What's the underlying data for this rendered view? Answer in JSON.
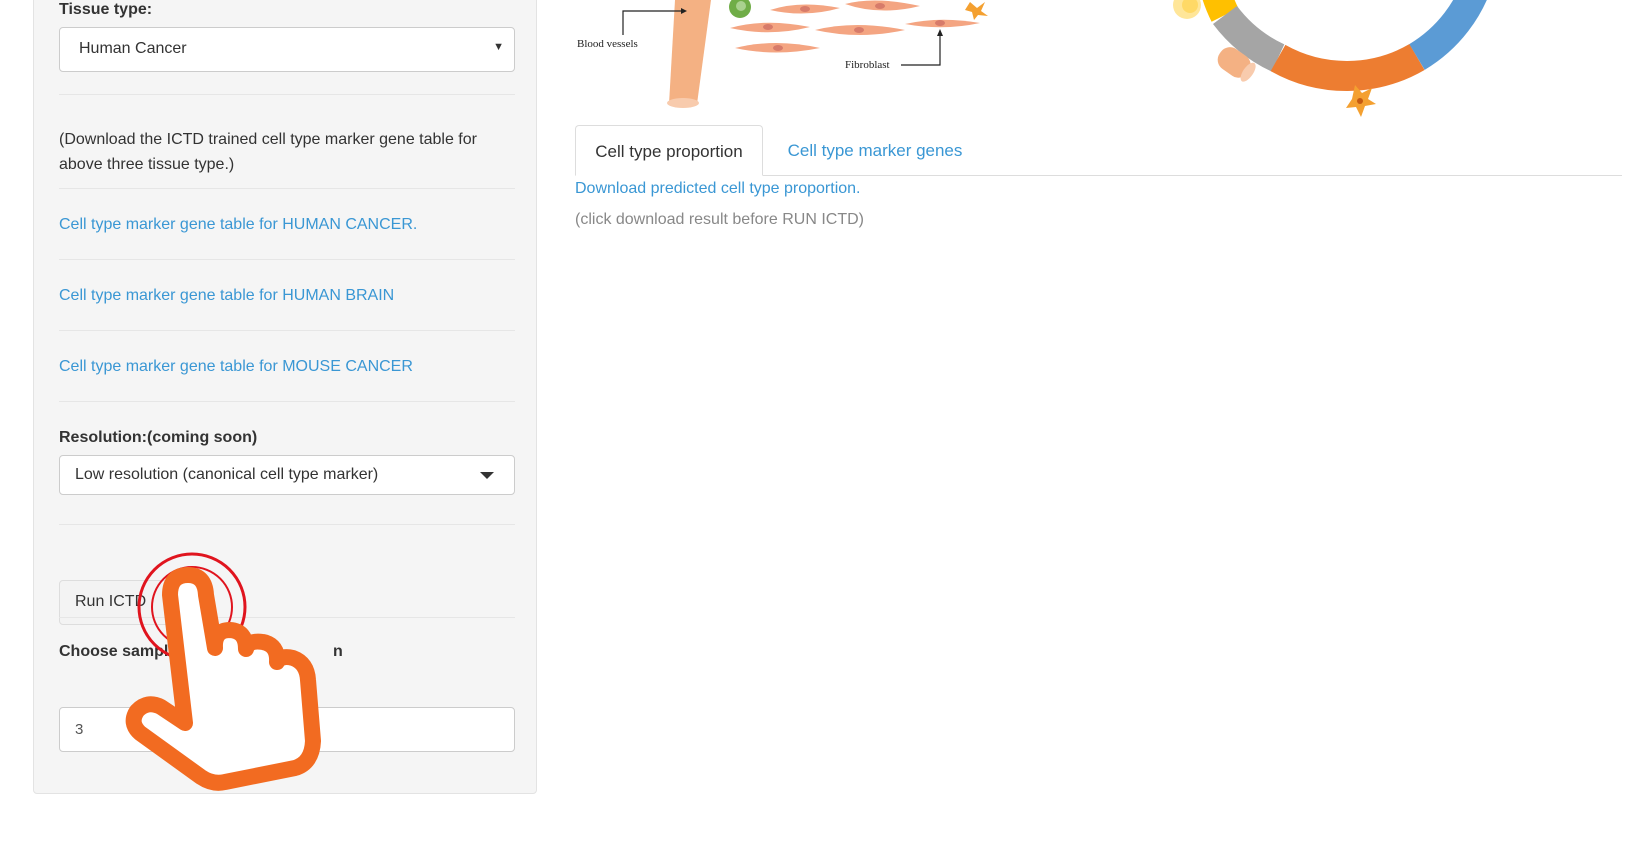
{
  "sidebar": {
    "tissue_label": "Tissue type:",
    "tissue_value": "Human Cancer",
    "note": "(Download the ICTD trained cell type marker gene table for above three tissue type.)",
    "links": [
      "Cell type marker gene table for HUMAN CANCER.",
      "Cell type marker gene table for HUMAN BRAIN",
      "Cell type marker gene table for MOUSE CANCER"
    ],
    "resolution_label": "Resolution:(coming soon)",
    "resolution_value": "Low resolution (canonical cell type marker)",
    "run_button": "Run ICTD",
    "sample_label": "Choose sample",
    "sample_label_tail": "n",
    "sample_value": "3"
  },
  "illustration": {
    "label_blood_vessels": "Blood vessels",
    "label_fibroblast": "Fibroblast"
  },
  "tabs": [
    {
      "label": "Cell type proportion",
      "active": true
    },
    {
      "label": "Cell type marker genes",
      "active": false
    }
  ],
  "main": {
    "download_link": "Download predicted cell type proportion.",
    "download_note": "(click download result before RUN ICTD)"
  },
  "colors": {
    "link": "#3a97d4",
    "overlay_hand": "#f26b21",
    "click_ring": "#e0141e",
    "donut_orange": "#ed7d31",
    "donut_blue": "#5b9bd5",
    "donut_gray": "#a5a5a5",
    "donut_yellow": "#ffc000"
  },
  "icons": [
    "hand-pointer-icon",
    "click-ring-icon",
    "dropdown-caret-icon"
  ]
}
